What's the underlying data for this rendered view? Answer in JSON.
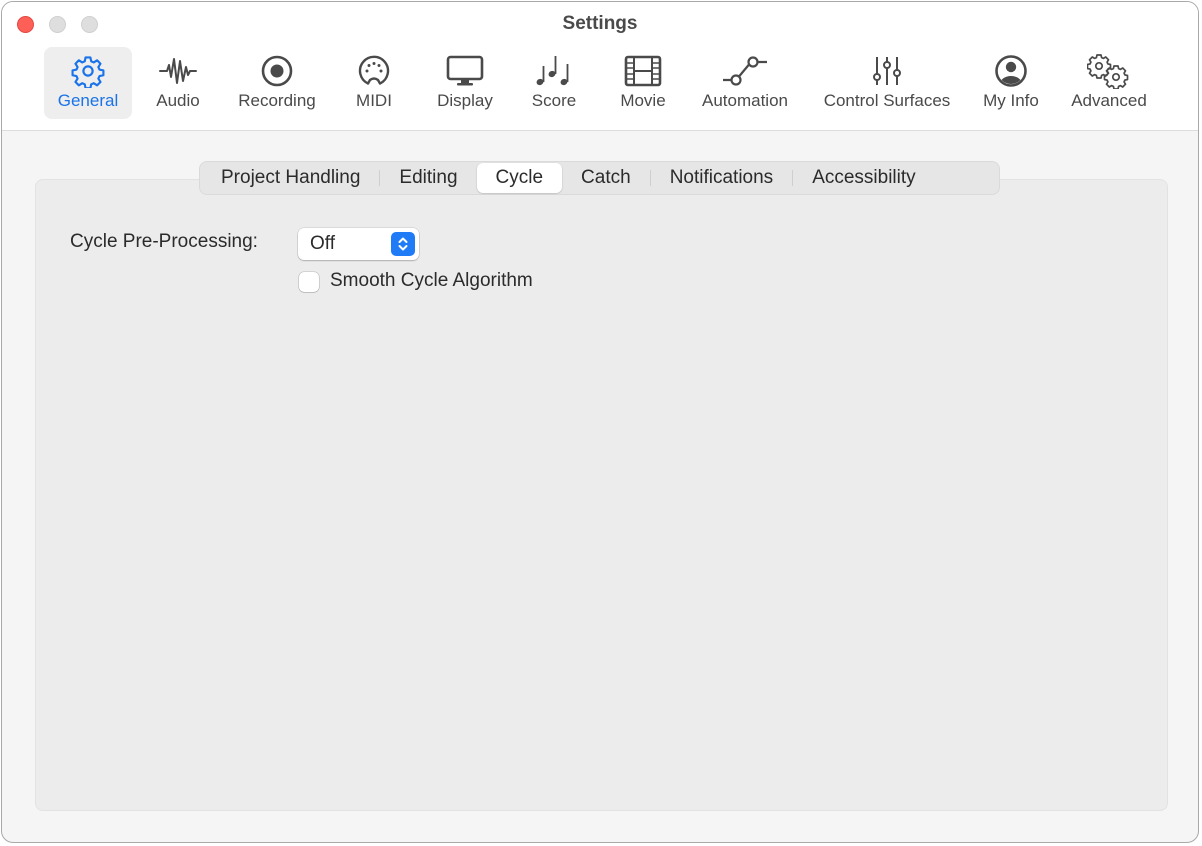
{
  "window": {
    "title": "Settings"
  },
  "toolbar": {
    "items": [
      {
        "label": "General",
        "icon": "gear-icon",
        "active": true
      },
      {
        "label": "Audio",
        "icon": "waveform-icon",
        "active": false
      },
      {
        "label": "Recording",
        "icon": "record-icon",
        "active": false
      },
      {
        "label": "MIDI",
        "icon": "midi-connector-icon",
        "active": false
      },
      {
        "label": "Display",
        "icon": "monitor-icon",
        "active": false
      },
      {
        "label": "Score",
        "icon": "music-notes-icon",
        "active": false
      },
      {
        "label": "Movie",
        "icon": "film-icon",
        "active": false
      },
      {
        "label": "Automation",
        "icon": "automation-curve-icon",
        "active": false
      },
      {
        "label": "Control Surfaces",
        "icon": "sliders-icon",
        "active": false
      },
      {
        "label": "My Info",
        "icon": "person-circle-icon",
        "active": false
      },
      {
        "label": "Advanced",
        "icon": "gears-icon",
        "active": false
      }
    ]
  },
  "tabs": [
    {
      "label": "Project Handling",
      "active": false
    },
    {
      "label": "Editing",
      "active": false
    },
    {
      "label": "Cycle",
      "active": true
    },
    {
      "label": "Catch",
      "active": false
    },
    {
      "label": "Notifications",
      "active": false
    },
    {
      "label": "Accessibility",
      "active": false
    }
  ],
  "cycle": {
    "preprocessing_label": "Cycle Pre-Processing:",
    "preprocessing_value": "Off",
    "smooth_label": "Smooth Cycle Algorithm",
    "smooth_checked": false
  },
  "colors": {
    "accent": "#1f7cf6",
    "close": "#fe5f57"
  }
}
